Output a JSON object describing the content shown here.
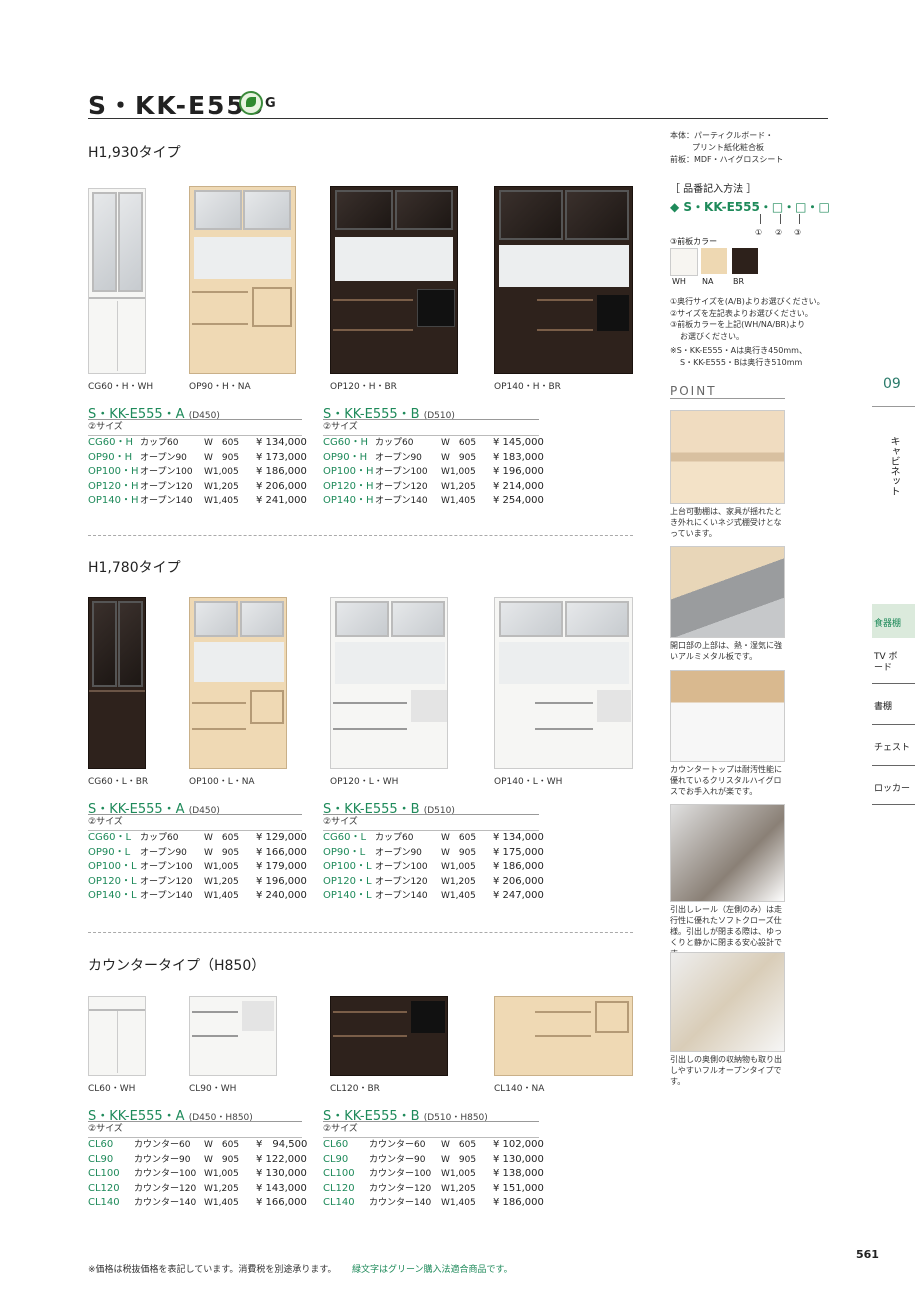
{
  "header": {
    "title": "S・KK-E555",
    "g_mark": "G"
  },
  "spec": {
    "line1": "本体：パーティクルボード・",
    "line2": "プリント紙化粧合板",
    "line3": "前板：MDF・ハイグロスシート"
  },
  "order": {
    "heading": "［ 品番記入方法 ］",
    "code": "◆ S・KK-E555・□・□・□",
    "nums": [
      "①",
      "②",
      "③"
    ],
    "color_label": "③前板カラー",
    "colors": [
      {
        "name": "WH",
        "hex": "#f7f5f1"
      },
      {
        "name": "NA",
        "hex": "#eed8b2"
      },
      {
        "name": "BR",
        "hex": "#2d211b"
      }
    ],
    "notes": [
      "①奥行サイズを(A/B)よりお選びください。",
      "②サイズを左記表よりお選びください。",
      "③前板カラーを上記(WH/NA/BR)より",
      "お選びください。"
    ],
    "note2": [
      "※S・KK-E555・Aは奥行き450mm、",
      "S・KK-E555・Bは奥行き510mm"
    ]
  },
  "point": {
    "label": "POINT",
    "captions": [
      "上台可動棚は、家具が揺れたとき外れにくいネジ式棚受けとなっています。",
      "開口部の上部は、熱・湿気に強いアルミメタル板です。",
      "カウンタートップは耐汚性能に優れているクリスタルハイグロスでお手入れが楽です。",
      "引出しレール（左側のみ）は走行性に優れたソフトクローズ仕様。引出しが閉まる際は、ゆっくりと静かに閉まる安心設計です。",
      "引出しの奥側の収納物も取り出しやすいフルオープンタイプです。"
    ]
  },
  "tabs": {
    "number": "09",
    "category": "キャビネット",
    "items": [
      "食器棚",
      "TV ボード",
      "書棚",
      "チェスト",
      "ロッカー"
    ]
  },
  "sections": [
    {
      "title": "H1,930タイプ",
      "captions": [
        "CG60・H・WH",
        "OP90・H・NA",
        "OP120・H・BR",
        "OP140・H・BR"
      ],
      "tables": [
        {
          "series": "S・KK-E555・A",
          "depth": "(D450)",
          "sub": "②サイズ",
          "rows": [
            [
              "CG60・H",
              "カップ60",
              "W　605",
              "¥ 134,000"
            ],
            [
              "OP90・H",
              "オープン90",
              "W　905",
              "¥ 173,000"
            ],
            [
              "OP100・H",
              "オープン100",
              "W1,005",
              "¥ 186,000"
            ],
            [
              "OP120・H",
              "オープン120",
              "W1,205",
              "¥ 206,000"
            ],
            [
              "OP140・H",
              "オープン140",
              "W1,405",
              "¥ 241,000"
            ]
          ]
        },
        {
          "series": "S・KK-E555・B",
          "depth": "(D510)",
          "sub": "②サイズ",
          "rows": [
            [
              "CG60・H",
              "カップ60",
              "W　605",
              "¥ 145,000"
            ],
            [
              "OP90・H",
              "オープン90",
              "W　905",
              "¥ 183,000"
            ],
            [
              "OP100・H",
              "オープン100",
              "W1,005",
              "¥ 196,000"
            ],
            [
              "OP120・H",
              "オープン120",
              "W1,205",
              "¥ 214,000"
            ],
            [
              "OP140・H",
              "オープン140",
              "W1,405",
              "¥ 254,000"
            ]
          ]
        }
      ]
    },
    {
      "title": "H1,780タイプ",
      "captions": [
        "CG60・L・BR",
        "OP100・L・NA",
        "OP120・L・WH",
        "OP140・L・WH"
      ],
      "tables": [
        {
          "series": "S・KK-E555・A",
          "depth": "(D450)",
          "sub": "②サイズ",
          "rows": [
            [
              "CG60・L",
              "カップ60",
              "W　605",
              "¥ 129,000"
            ],
            [
              "OP90・L",
              "オープン90",
              "W　905",
              "¥ 166,000"
            ],
            [
              "OP100・L",
              "オープン100",
              "W1,005",
              "¥ 179,000"
            ],
            [
              "OP120・L",
              "オープン120",
              "W1,205",
              "¥ 196,000"
            ],
            [
              "OP140・L",
              "オープン140",
              "W1,405",
              "¥ 240,000"
            ]
          ]
        },
        {
          "series": "S・KK-E555・B",
          "depth": "(D510)",
          "sub": "②サイズ",
          "rows": [
            [
              "CG60・L",
              "カップ60",
              "W　605",
              "¥ 134,000"
            ],
            [
              "OP90・L",
              "オープン90",
              "W　905",
              "¥ 175,000"
            ],
            [
              "OP100・L",
              "オープン100",
              "W1,005",
              "¥ 186,000"
            ],
            [
              "OP120・L",
              "オープン120",
              "W1,205",
              "¥ 206,000"
            ],
            [
              "OP140・L",
              "オープン140",
              "W1,405",
              "¥ 247,000"
            ]
          ]
        }
      ]
    },
    {
      "title": "カウンタータイプ（H850）",
      "captions": [
        "CL60・WH",
        "CL90・WH",
        "CL120・BR",
        "CL140・NA"
      ],
      "tables": [
        {
          "series": "S・KK-E555・A",
          "depth": "(D450・H850)",
          "sub": "②サイズ",
          "rows": [
            [
              "CL60",
              "カウンター60",
              "W　605",
              "¥　94,500"
            ],
            [
              "CL90",
              "カウンター90",
              "W　905",
              "¥ 122,000"
            ],
            [
              "CL100",
              "カウンター100",
              "W1,005",
              "¥ 130,000"
            ],
            [
              "CL120",
              "カウンター120",
              "W1,205",
              "¥ 143,000"
            ],
            [
              "CL140",
              "カウンター140",
              "W1,405",
              "¥ 166,000"
            ]
          ]
        },
        {
          "series": "S・KK-E555・B",
          "depth": "(D510・H850)",
          "sub": "②サイズ",
          "rows": [
            [
              "CL60",
              "カウンター60",
              "W　605",
              "¥ 102,000"
            ],
            [
              "CL90",
              "カウンター90",
              "W　905",
              "¥ 130,000"
            ],
            [
              "CL100",
              "カウンター100",
              "W1,005",
              "¥ 138,000"
            ],
            [
              "CL120",
              "カウンター120",
              "W1,205",
              "¥ 151,000"
            ],
            [
              "CL140",
              "カウンター140",
              "W1,405",
              "¥ 186,000"
            ]
          ]
        }
      ]
    }
  ],
  "footer": {
    "note": "※価格は税抜価格を表記しています。消費税を別途承ります。",
    "green_note": "緑文字はグリーン購入法適合商品です。",
    "page": "561"
  }
}
